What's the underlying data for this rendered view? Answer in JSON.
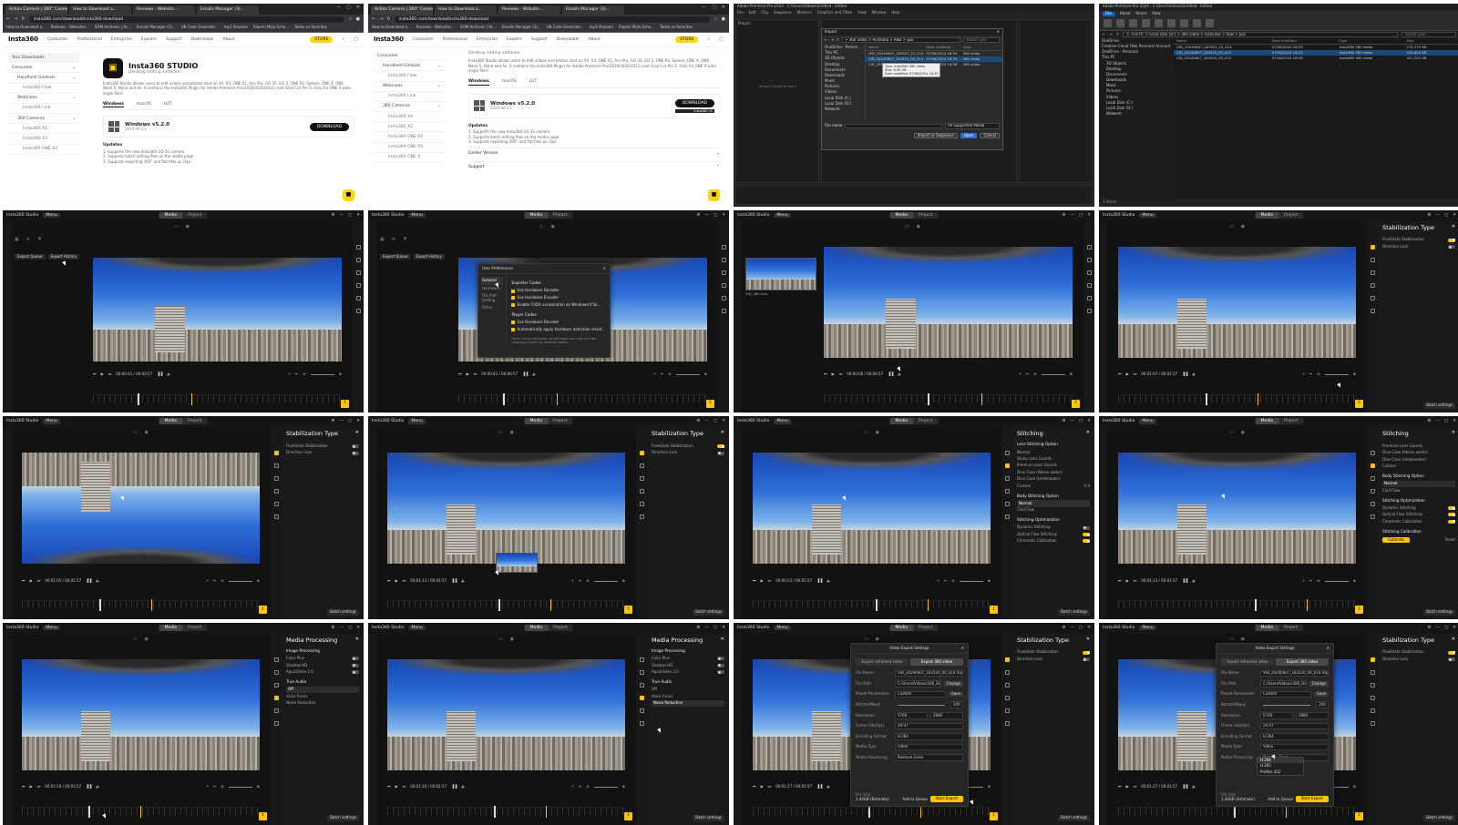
{
  "tile1": {
    "tabs": [
      "Action Camera | 360° Camera",
      "How to Download a...",
      "Reviews - Website...",
      "Emails Manager (3)..."
    ],
    "url": "insta360.com/download/insta360-download",
    "bookmarks": [
      "How to Download a...",
      "Reviews - Websites...",
      "SOM Archives | Ac...",
      "Emails Manager (3)...",
      "UB Code Generate...",
      "mp3 Shazam",
      "Xiaomi Mijia Sche...",
      "Todos os favoritos"
    ],
    "nav": {
      "logo": "Insta360",
      "items": [
        "Consumer",
        "Professional",
        "Enterprise",
        "Explore",
        "Support",
        "Downloads",
        "About"
      ],
      "store": "STORE"
    },
    "sidebar": [
      {
        "label": "Your Downloads",
        "level": 0
      },
      {
        "label": "Consumer",
        "level": 0
      },
      {
        "label": "Handheld Gimbals",
        "level": 1
      },
      {
        "label": "Insta360 Flow",
        "level": 2
      },
      {
        "label": "Webcams",
        "level": 1
      },
      {
        "label": "Insta360 Link",
        "level": 2
      },
      {
        "label": "360 Cameras",
        "level": 1
      },
      {
        "label": "Insta360 X4",
        "level": 2
      },
      {
        "label": "Insta360 X3",
        "level": 2
      },
      {
        "label": "Insta360 ONE X2",
        "level": 2
      }
    ],
    "product": {
      "title": "Insta360 STUDIO",
      "subtitle": "Desktop editing software",
      "desc": "Insta360 Studio allows users to edit videos and photos shot on X4, X3, ONE X2, Ace Pro, GO 3S, GO 3, ONE RS, Sphere, ONE X, ONE, Nano S, Nano and Air. It contains the Insta360 Plugin for Adobe Premiere Pro(2019/2020/2021) and Final Cut Pro X. Only for ONE X wide angle files!",
      "os_tabs": [
        "Windows",
        "macOS",
        "LUT"
      ],
      "version": "Windows v5.2.0",
      "date": "2024-06-13",
      "download": "DOWNLOAD",
      "updates_title": "Updates",
      "updates": [
        "1. Supports the new Insta360 GO 3S camera",
        "2. Supports batch editing files on the media page",
        "3. Supports exporting 360° and flat files as clips"
      ]
    }
  },
  "tile2": {
    "side_extra": [
      "Consumer",
      "Handheld Gimbals",
      "Insta360 Flow",
      "Webcams",
      "Insta360 Link",
      "360 Cameras",
      "Insta360 X4",
      "Insta360 X3",
      "Insta360 ONE X2",
      "Insta360 ONE RS",
      "Insta360 ONE X"
    ],
    "tooltip": "Insta360 v5",
    "earlier": "Earlier Version",
    "support": "Support"
  },
  "tile3": {
    "title": "Adobe Premiere Pro 2024 - C:\\Users\\Videos\\Untitled - Edited",
    "menu": [
      "File",
      "Edit",
      "Clip",
      "Sequence",
      "Markers",
      "Graphics and Titles",
      "View",
      "Window",
      "Help"
    ],
    "dialog_title": "Import",
    "path": "> 360 video > Australia > Raw > pov",
    "search": "Search pov",
    "tree": [
      "OneDrive - Person",
      "This PC",
      "3D Objects",
      "Desktop",
      "Documents",
      "Downloads",
      "Music",
      "Pictures",
      "Videos",
      "Local Disk (C:)",
      "Local Disk (D:)",
      "Network"
    ],
    "cols": [
      "Name",
      "Date modified",
      "Type"
    ],
    "files": [
      {
        "name": "LRV_20240607_183521_01_014",
        "date": "07/06/2024 18:35",
        "type": "360 video"
      },
      {
        "name": "VID_20240607_183520_00_014",
        "date": "07/06/2024 18:35",
        "type": "360 video"
      },
      {
        "name": "VID_20240607_183520_00_015",
        "date": "07/06/2024 18:36",
        "type": "360 video"
      }
    ],
    "hover": [
      "Type: Insta360 360 video",
      "Size: 6.00 GB",
      "Date modified: 07/06/2024 18:35"
    ],
    "filename_label": "File name",
    "filter": "All Supported Media",
    "btn_seq": "Import as Sequence",
    "btn_open": "Open",
    "btn_cancel": "Cancel",
    "project_label": "Project",
    "import_hint": "Import media to start"
  },
  "tile4": {
    "title": "Adobe Premiere Pro 2024 - C:\\Users\\Videos\\Untitled - Edited",
    "tabs": [
      "File",
      "Home",
      "Share",
      "View"
    ],
    "path": "> This PC > Local Disk (D:) > 360 video > Australia > Raw > pov",
    "search": "Search pov",
    "tree": [
      "OneDrive",
      "Creative Cloud Files Personal Account",
      "OneDrive - Personal",
      "This PC",
      "3D Objects",
      "Desktop",
      "Documents",
      "Downloads",
      "Music",
      "Pictures",
      "Videos",
      "Local Disk (C:)",
      "Local Disk (D:)",
      "Network"
    ],
    "cols": [
      "Name",
      "Date modified",
      "Type",
      "Size"
    ],
    "files": [
      {
        "name": "LRV_20240607_183521_01_014",
        "date": "07/06/2024 18:35",
        "type": "Insta360 360 video",
        "size": "275,779 KB"
      },
      {
        "name": "VID_20240607_183520_00_014",
        "date": "07/06/2024 18:35",
        "type": "Insta360 360 video",
        "size": "945,600 KB"
      },
      {
        "name": "VID_20240607_183520_00_015",
        "date": "07/06/2024 18:36",
        "type": "Insta360 360 video",
        "size": "451,201 KB"
      }
    ],
    "status": "3 items"
  },
  "studio": {
    "app": "Insta360 Studio",
    "menu": "Menu",
    "seg": [
      "Media",
      "Project"
    ],
    "timecodes": [
      "00:00:41 / 00:00:57",
      "00:00:41 / 00:00:57",
      "00:00:00 / 00:00:57",
      "00:01:07 / 00:01:57",
      "00:01:05 / 00:01:57",
      "00:01:13 / 00:01:57",
      "00:00:23 / 00:01:57",
      "00:01:13 / 00:01:57",
      "00:01:20 / 00:01:57",
      "00:01:20 / 00:01:57",
      "00:01:27 / 00:01:57",
      "00:01:27 / 00:01:57"
    ],
    "batch": "Batch settings",
    "export_queue": "Export Queue",
    "export_history": "Export History",
    "gallery_label": "VID_360.insv",
    "playhead": [
      0.18,
      0.18,
      0.42,
      0.37,
      0.33,
      0.47,
      0.52,
      0.58,
      0.28,
      0.45,
      0.49,
      0.49
    ]
  },
  "prefs": {
    "title": "User Preferences",
    "nav": [
      "General",
      "Hardware",
      "File Path Setting",
      "Other"
    ],
    "sec1": "Exporter Codec",
    "opts1": [
      "Use Hardware Decoder",
      "Use Hardware Encoder",
      "Enable CUDA acceleration on Windows(If fai..."
    ],
    "sec2": "Player Codec",
    "opts2": [
      "Use Hardware Decoder",
      "Automatically apply hardware detection result..."
    ],
    "note": "Note: Using hardware acceleration can improve the exporting speed or preview speed."
  },
  "stab": {
    "title": "Stabilization Type",
    "opts": [
      "FlowState Stabilization",
      "Direction Lock"
    ],
    "states": [
      [
        true,
        false
      ],
      [
        false,
        false
      ],
      [
        true,
        false
      ],
      [
        true,
        false
      ],
      [
        true,
        false
      ]
    ]
  },
  "stitch": {
    "title": "Stitching",
    "lens_sec": "Lens Stitching Option",
    "lens_opts": [
      "Normal",
      "Sticky Lens Guards",
      "Premium Lens Guards",
      "Dive Case (Above water)",
      "Dive Case (Underwater)",
      "Custom"
    ],
    "custom_val": "0.0",
    "body_sec": "Body Stitching Option",
    "body_opts": [
      "Normal",
      "Cold Flow"
    ],
    "opt_sec": "Stitching Optimization",
    "opt_opts": [
      "Dynamic Stitching",
      "Optical Flow Stitching",
      "Chromatic Calibration"
    ],
    "cal_sec": "Stitching Calibration",
    "cal_btn": "Calibrate",
    "cal_reset": "Reset"
  },
  "media": {
    "title": "Media Processing",
    "img_sec": "Image Processing",
    "img_opts": [
      "Color Plus",
      "Shadow HD",
      "AquaVision 2.0"
    ],
    "audio_sec": "True Audio",
    "audio_opts_a": [
      "Off",
      "Voice Focus",
      "Noise Reduction"
    ],
    "audio_opts_b": [
      "Off",
      "Voice Focus",
      "Noise Reduction"
    ]
  },
  "export": {
    "title": "Video Export Settings",
    "tabs": [
      "Export reframed video",
      "Export 360 video"
    ],
    "file_name_lbl": "File Name",
    "file_name": "VID_20240607_183520_00_014.mp4",
    "path_lbl": "File Path",
    "path": "C:/Users/Videos/360_Desktop",
    "change": "Change",
    "preset_lbl": "Preset Parameters",
    "preset": "Custom",
    "save": "Save",
    "bitrate_lbl": "Bitrate(Mbps)",
    "bitrate": "200",
    "res_lbl": "Resolution",
    "res_w": "5760",
    "res_h": "2880",
    "fr_lbl": "Frame rate(fps)",
    "fr": "29.97",
    "enc_lbl": "Encoding Format",
    "enc": "H.264",
    "mode_lbl": "Media Type",
    "mode": "Video",
    "proc_lbl": "Media Processing",
    "proc": "Remove Grain",
    "size_lbl": "File Size",
    "size": "1.44GB (Estimate)",
    "queue": "Add to Queue",
    "start": "Start Export",
    "enc_options": [
      "H.264",
      "H.265",
      "ProRes 422"
    ]
  },
  "colors": {
    "accent": "#ffc400",
    "store": "#ffd400",
    "win_blue": "#0a64c6"
  }
}
